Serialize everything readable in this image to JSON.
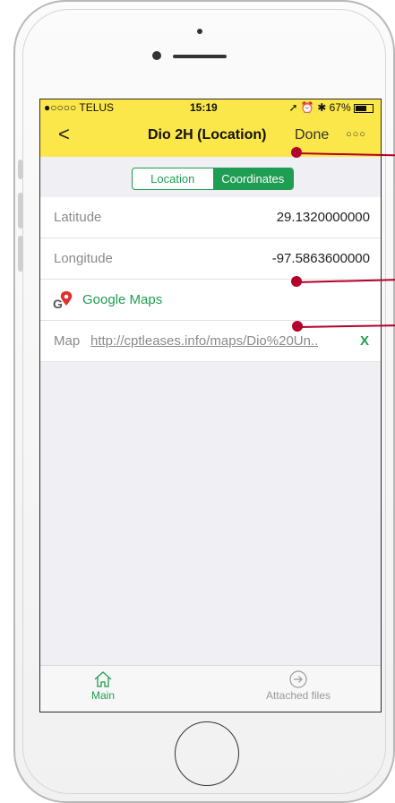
{
  "status_bar": {
    "carrier": "●○○○○ TELUS",
    "time": "15:19",
    "battery": "67%"
  },
  "nav": {
    "back_glyph": "<",
    "title": "Dio 2H (Location)",
    "done_label": "Done",
    "more_glyph": "○○○"
  },
  "segmented": {
    "options": [
      "Location",
      "Coordinates"
    ],
    "selected": "Coordinates"
  },
  "rows": {
    "latitude": {
      "label": "Latitude",
      "value": "29.1320000000"
    },
    "longitude": {
      "label": "Longitude",
      "value": "-97.5863600000"
    },
    "google_maps": {
      "label": "Google Maps",
      "icon": "google-maps-pin-icon"
    },
    "map": {
      "label": "Map",
      "link": "http://cptleases.info/maps/Dio%20Un..",
      "clear": "X"
    }
  },
  "tabbar": {
    "main": {
      "label": "Main",
      "icon": "home-icon"
    },
    "files": {
      "label": "Attached files",
      "icon": "arrow-circle-icon"
    }
  },
  "colors": {
    "accent_green": "#1f9d52",
    "header_yellow": "#fbe74a",
    "callout_red": "#b3002d"
  }
}
